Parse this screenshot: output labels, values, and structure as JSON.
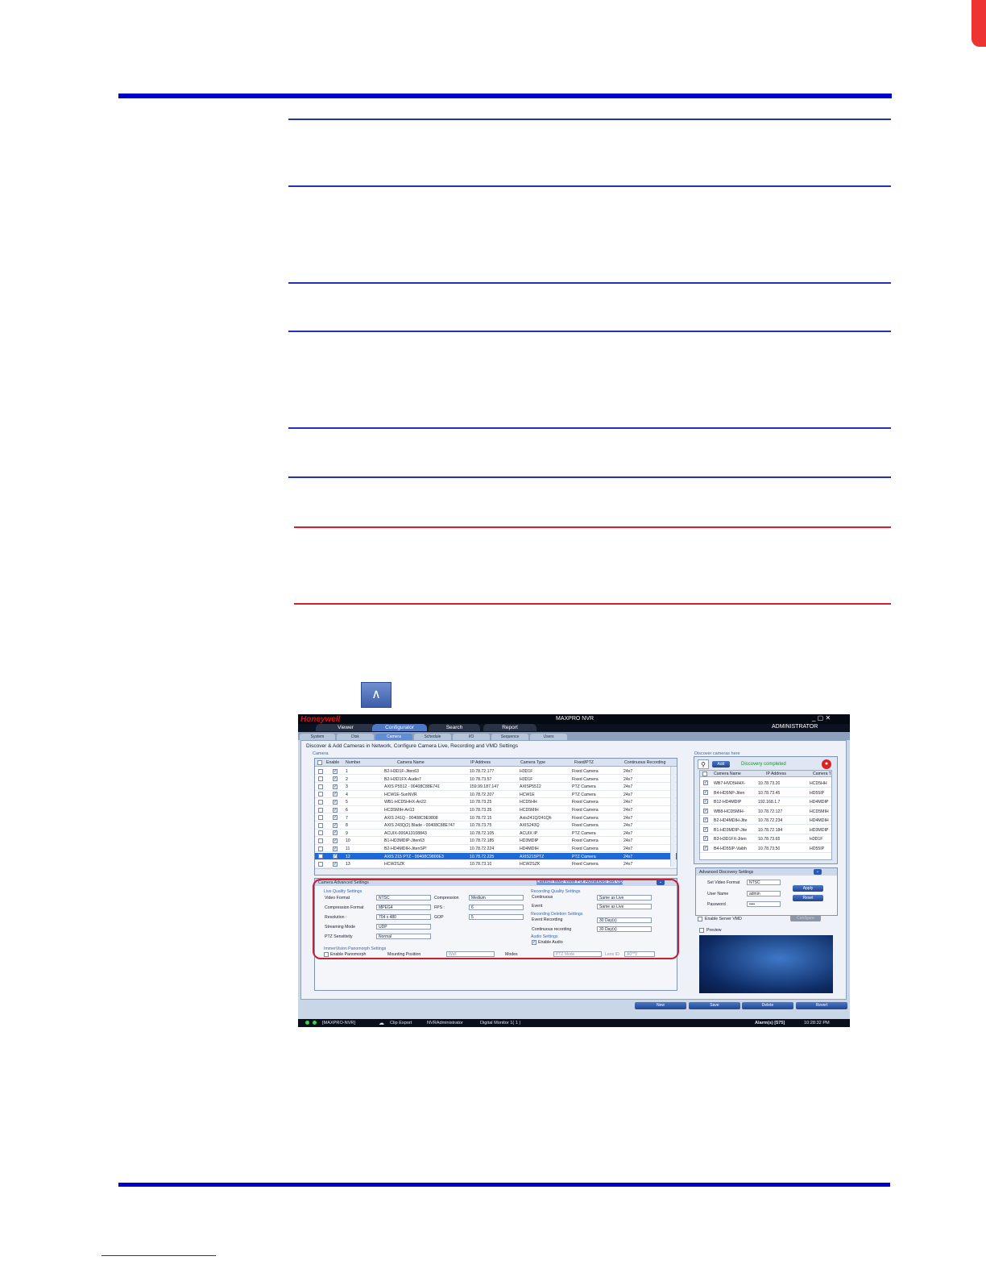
{
  "app": {
    "logo": "Honeywell",
    "title": "MAXPRO NVR",
    "window_controls": "_ ▢ ✕",
    "user": "ADMINISTRATOR"
  },
  "menu": {
    "tabs": [
      "Viewer",
      "Configurator",
      "Search",
      "Report"
    ],
    "active": "Configurator"
  },
  "subtabs": {
    "items": [
      "System",
      "Disk",
      "Camera",
      "Schedule",
      "I/O",
      "Sequence",
      "Users"
    ],
    "active": "Camera"
  },
  "camera_page": {
    "heading": "Discover & Add Cameras in Network, Configure Camera Live, Recording and VMD Settings",
    "group_label": "Camera",
    "columns": [
      "Enable",
      "Number",
      "Camera Name",
      "IP Address",
      "Camera Type",
      "Fixed/PTZ",
      "Continuous Recording"
    ],
    "rows": [
      {
        "n": "1",
        "name": "B2-H3D1F-Jiten63",
        "ip": "10.78.72.177",
        "type": "H3D1F",
        "ptz": "Fixed Camera",
        "rec": "24x7"
      },
      {
        "n": "2",
        "name": "B2-H3D1FX-Audio7",
        "ip": "10.78.73.57",
        "type": "H3D1F",
        "ptz": "Fixed Camera",
        "rec": "24x7"
      },
      {
        "n": "3",
        "name": "AXIS P5512 - 00408C88E741",
        "ip": "159.99.187.147",
        "type": "AXISP5512",
        "ptz": "PTZ Camera",
        "rec": "24x7"
      },
      {
        "n": "4",
        "name": "HCW1E-SunNVR",
        "ip": "10.78.72.207",
        "type": "HCW1E",
        "ptz": "PTZ Camera",
        "rec": "24x7"
      },
      {
        "n": "5",
        "name": "WB1-HCD5HHX-Ari22",
        "ip": "10.78.73.25",
        "type": "HCD5HH",
        "ptz": "Fixed Camera",
        "rec": "24x7"
      },
      {
        "n": "6",
        "name": "HCD5MIH-Ari13",
        "ip": "10.78.73.35",
        "type": "HCD5MIH",
        "ptz": "Fixed Camera",
        "rec": "24x7"
      },
      {
        "n": "7",
        "name": "AXIS 241Q - 00408C9E9808",
        "ip": "10.78.72.15",
        "type": "Axis241Q/241Qh",
        "ptz": "Fixed Camera",
        "rec": "24x7"
      },
      {
        "n": "8",
        "name": "AXIS 243Q(2) Blade - 00408C88E747",
        "ip": "10.78.73.75",
        "type": "AXIS243Q",
        "ptz": "Fixed Camera",
        "rec": "24x7"
      },
      {
        "n": "9",
        "name": "ACUIX-000A13108843",
        "ip": "10.78.72.105",
        "type": "ACUIX IP",
        "ptz": "PTZ Camera",
        "rec": "24x7"
      },
      {
        "n": "10",
        "name": "B1-HD3MDIP-Jiten63",
        "ip": "10.78.72.185",
        "type": "HD3MDIP",
        "ptz": "Fixed Camera",
        "rec": "24x7"
      },
      {
        "n": "11",
        "name": "B2-HD4MDIH-JitenSP!",
        "ip": "10.78.72.224",
        "type": "HD4MDIH",
        "ptz": "Fixed Camera",
        "rec": "24x7"
      },
      {
        "n": "12",
        "name": "AXIS 215 PTZ - 00408C9800E3",
        "ip": "10.78.72.225",
        "type": "AXIS215PTZ",
        "ptz": "PTZ Camera",
        "rec": "24x7"
      },
      {
        "n": "13",
        "name": "HCW2SZK",
        "ip": "10.78.73.10",
        "type": "HCW2SZK",
        "ptz": "Fixed Camera",
        "rec": "24x7"
      }
    ],
    "selected_row": 11
  },
  "advanced": {
    "title": "Camera Advanced Settings",
    "link": "Launch Web View For Advanced Set Up",
    "live_title": "Live Quality Settings",
    "video_format_label": "Video Format",
    "video_format": "NTSC",
    "compression_label": "Compression",
    "compression": "Medium",
    "comp_format_label": "Compression Format",
    "comp_format": "MPEG4",
    "fps_label": "FPS :",
    "fps": "6",
    "resolution_label": "Resolution :",
    "resolution": "704 x 480",
    "gop_label": "GOP",
    "gop": "5",
    "streaming_label": "Streaming Mode",
    "streaming": "UDP",
    "ptz_sens_label": "PTZ Sensitivity",
    "ptz_sens": "Normal",
    "rec_title": "Recording Quality Settings",
    "continuous_label": "Continuous",
    "continuous": "Same as Live",
    "event_label": "Event",
    "event": "Same as Live",
    "del_title": "Recording Deletion Settings",
    "event_rec_label": "Event Recording",
    "event_rec": "30 Day(s)",
    "cont_rec_label": "Continuous recording",
    "cont_rec": "30 Day(s)",
    "audio_title": "Audio Settings",
    "audio_enable": "Enable Audio",
    "pano_title": "ImmerVision Panomorph Settings",
    "pano_enable": "Enable Panomorph",
    "mount_label": "Mounting Position",
    "mount": "Wall",
    "modes_label": "Modes",
    "modes": "PTZ Mode",
    "lens_label": "Lens ID",
    "lens": "A0**V"
  },
  "discover": {
    "title": "Discover cameras here",
    "add": "Add",
    "status": "Discovery completed",
    "columns": [
      "Camera Name",
      "IP Address",
      "Camera Type"
    ],
    "rows": [
      {
        "name": "WB7-HVD5HHX-",
        "ip": "10.78.73.20",
        "type": "HCD5HH"
      },
      {
        "name": "B4-HD5NP-Jiten",
        "ip": "10.78.73.45",
        "type": "HD55IP"
      },
      {
        "name": "B12-HD4MDIP",
        "ip": "192.168.1.7",
        "type": "HD4MDIP"
      },
      {
        "name": "WB8-HCD5MIH-",
        "ip": "10.78.72.127",
        "type": "HCD5MIH"
      },
      {
        "name": "B2-HD4MDIH-Jite",
        "ip": "10.78.72.234",
        "type": "HD4MDIH"
      },
      {
        "name": "B1-HD3MDIP-Jite",
        "ip": "10.78.72.184",
        "type": "HD3MDIP"
      },
      {
        "name": "B3-H3D1FX-Jiten",
        "ip": "10.78.73.65",
        "type": "H3D1F"
      },
      {
        "name": "B4-HD55IP-Vaibh",
        "ip": "10.78.73.50",
        "type": "HD55IP"
      }
    ],
    "adv_title": "Advanced Discovery Settings",
    "video_format_label": "Set Video Format",
    "video_format": "NTSC",
    "user_label": "User Name",
    "user": "admin",
    "pass_label": "Password",
    "pass": "••••",
    "apply": "Apply",
    "reset": "Reset",
    "vmd": "Enable Server VMD",
    "vmd_btn": "Configure",
    "preview": "Preview"
  },
  "buttons": [
    "New",
    "Save",
    "Delete",
    "Revert"
  ],
  "status": {
    "server": "[MAXPRO-NVR]",
    "clip": "Clip Export",
    "user": "NVRAdministrator",
    "monitor": "Digital Monitor 1( 1 )",
    "alarms": "Alarm(s) [575]",
    "time": "10:28:32 PM"
  }
}
